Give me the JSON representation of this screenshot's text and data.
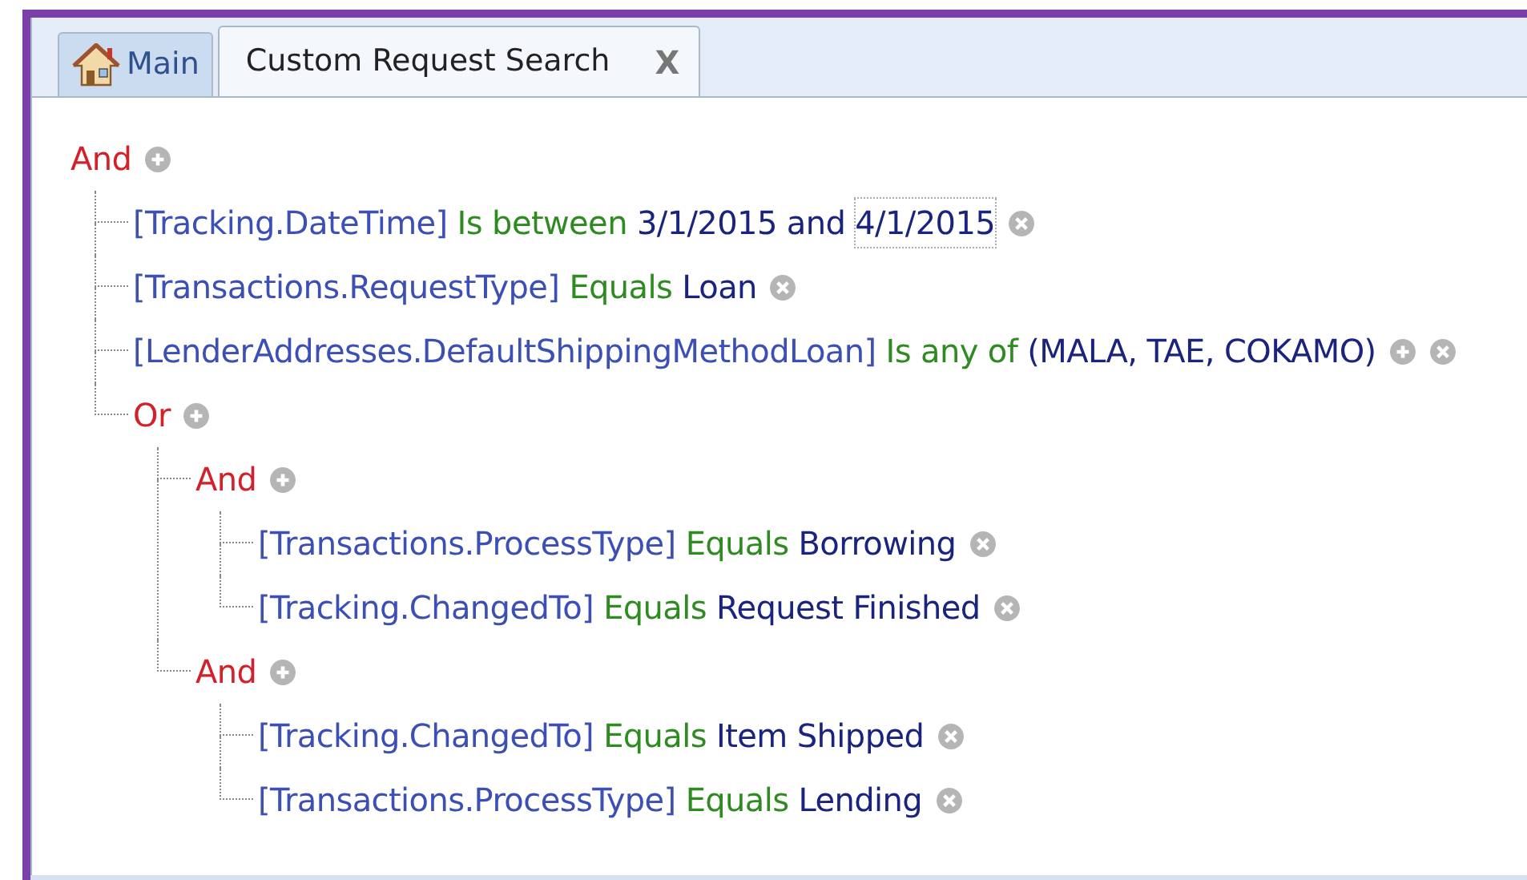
{
  "tabs": [
    {
      "label": "Main",
      "kind": "home",
      "selected": false,
      "closable": false
    },
    {
      "label": "Custom Request Search",
      "kind": "plain",
      "selected": true,
      "closable": true,
      "close_label": "X"
    }
  ],
  "tree": {
    "kind": "group",
    "label": "And",
    "children": [
      {
        "kind": "condition",
        "field": "[Tracking.DateTime]",
        "operator": "Is between",
        "values": [
          "3/1/2015",
          "4/1/2015"
        ],
        "joiner": "and",
        "addable": false
      },
      {
        "kind": "condition",
        "field": "[Transactions.RequestType]",
        "operator": "Equals",
        "values": [
          "Loan"
        ],
        "addable": false
      },
      {
        "kind": "condition",
        "field": "[LenderAddresses.DefaultShippingMethodLoan]",
        "operator": "Is any of",
        "values": [
          "(MALA, TAE, COKAMO)"
        ],
        "addable": true
      },
      {
        "kind": "group",
        "label": "Or",
        "children": [
          {
            "kind": "group",
            "label": "And",
            "children": [
              {
                "kind": "condition",
                "field": "[Transactions.ProcessType]",
                "operator": "Equals",
                "values": [
                  "Borrowing"
                ],
                "addable": false
              },
              {
                "kind": "condition",
                "field": "[Tracking.ChangedTo]",
                "operator": "Equals",
                "values": [
                  "Request Finished"
                ],
                "addable": false
              }
            ]
          },
          {
            "kind": "group",
            "label": "And",
            "children": [
              {
                "kind": "condition",
                "field": "[Tracking.ChangedTo]",
                "operator": "Equals",
                "values": [
                  "Item Shipped"
                ],
                "addable": false
              },
              {
                "kind": "condition",
                "field": "[Transactions.ProcessType]",
                "operator": "Equals",
                "values": [
                  "Lending"
                ],
                "addable": false
              }
            ]
          }
        ]
      }
    ]
  }
}
